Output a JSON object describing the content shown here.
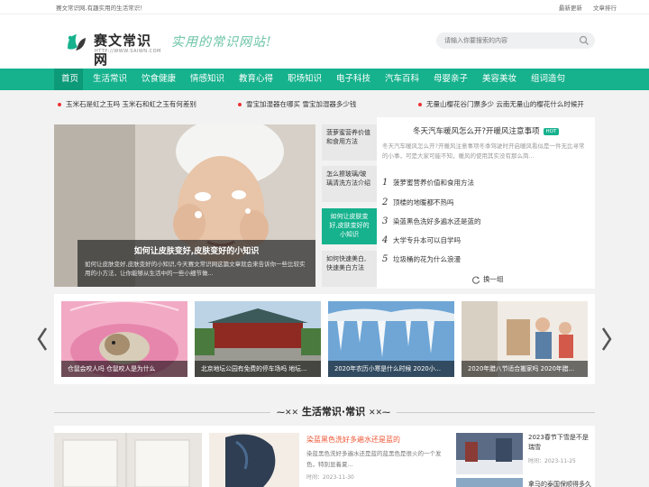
{
  "topbar": {
    "welcome": "赛文常识网,有趣实用的生活常识！",
    "links": [
      "最新更新",
      "文章排行"
    ]
  },
  "header": {
    "logo_text": "赛文常识网",
    "logo_url": "HTTP://WWW.SAIWN.COM",
    "slogan": "实用的常识网站!",
    "search_placeholder": "请输入你要搜索的内容"
  },
  "nav": {
    "items": [
      "首页",
      "生活常识",
      "饮食健康",
      "情感知识",
      "教育心得",
      "职场知识",
      "电子科技",
      "汽车百科",
      "母婴亲子",
      "美容美妆",
      "组词造句"
    ]
  },
  "ticker": {
    "items": [
      "玉米石是虹之玉吗 玉米石和虹之玉有何差别",
      "雪宝加湿器在哪买 雪宝加湿器多少钱",
      "无量山樱花谷门票多少 云南无量山的樱花什么时候开"
    ]
  },
  "hero": {
    "title": "如何让皮肤变好,皮肤变好的小知识",
    "desc": "如何让皮肤变好,皮肤变好的小知识,今天赛文常识网这篇文章就会来告诉你一些比较实用的小方法，让你能够从生活中的一些小细节做..."
  },
  "side_tabs": [
    {
      "label": "菠萝蜜营养价值和食用方法",
      "active": false
    },
    {
      "label": "怎么擦玻璃/玻璃清洗方法介绍",
      "active": false
    },
    {
      "label": "如何让皮肤变好,皮肤变好的小知识",
      "active": true
    },
    {
      "label": "如何快速美白,快速美白方法",
      "active": false
    }
  ],
  "hotbox": {
    "title": "冬天汽车暖风怎么开?开暖风注意事项",
    "badge": "HOT",
    "desc": "冬天汽车暖风怎么开?开暖风注意事项冬季驾驶时开启暖风看似是一件无比寻常的小事，可是大家可能不知，暖风的使用其实没有那么简...",
    "list": [
      {
        "n": "1",
        "text": "菠萝蜜营养价值和食用方法"
      },
      {
        "n": "2",
        "text": "顶楼的地暖都不热吗"
      },
      {
        "n": "3",
        "text": "染蓝黑色洗好多遍水还是蓝的"
      },
      {
        "n": "4",
        "text": "大学专升本可以自学吗"
      },
      {
        "n": "5",
        "text": "垃圾桶的花为什么浪漫"
      }
    ],
    "swap_label": "换一组"
  },
  "gallery": [
    "仓鼠会咬人吗 仓鼠咬人是为什么",
    "北京地坛公园有免费的停车场吗 地坛...",
    "2020年农历小寒是什么时候 2020小...",
    "2020年腊八节适合搬家吗 2020年腊..."
  ],
  "section": {
    "title": "生活常识·常识"
  },
  "bottom": {
    "article_title": "染蓝黑色洗好多遍水还是蓝的",
    "article_desc": "染蓝黑色洗好多遍水还是蓝的蓝黑色是很火的一个发色，特别显着夏...",
    "article_time": "时间：2023-11-30",
    "right_title": "2023春节下雪是不是瑞雪",
    "right_time": "时间：2023-11-25",
    "right_title2": "拿马的泰国保顺得多久"
  },
  "colors": {
    "accent": "#16b28d",
    "nav_active": "#0d9a79"
  }
}
